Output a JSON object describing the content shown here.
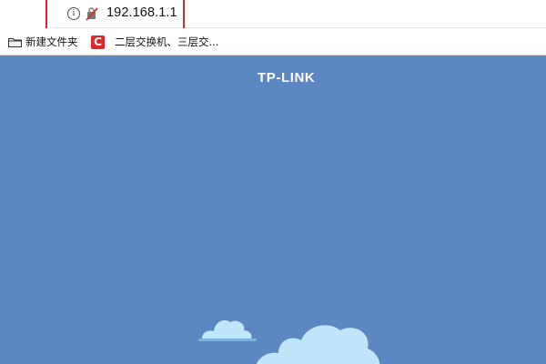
{
  "browser": {
    "address_bar": {
      "url": "192.168.1.1",
      "info_icon": "info-icon",
      "security_icon": "not-secure-icon",
      "highlight_color": "#e0242b"
    },
    "bookmarks": [
      {
        "label": "新建文件夹",
        "icon": "folder-icon"
      },
      {
        "label": "",
        "icon": "c-site-icon"
      },
      {
        "label": "二层交换机、三层交...",
        "icon": ""
      }
    ]
  },
  "router_page": {
    "brand": "TP-LINK",
    "background_color": "#5c87c1",
    "cloud_color": "#bfe6fa"
  }
}
